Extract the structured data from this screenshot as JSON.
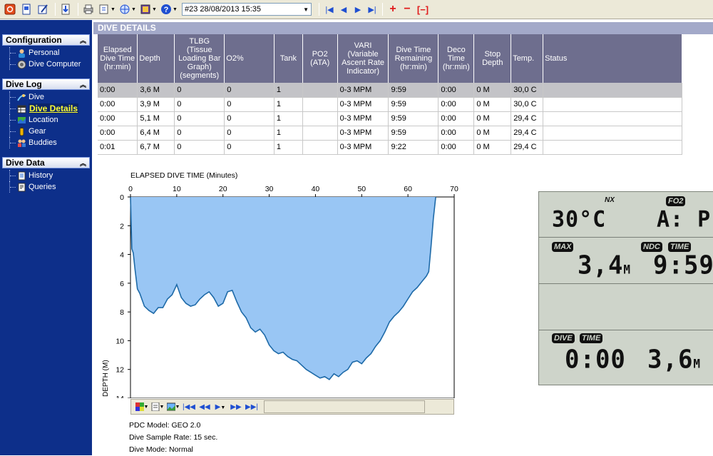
{
  "toolbar": {
    "dive_selector": "#23 28/08/2013 15:35",
    "icons": [
      "exit-icon",
      "new-icon",
      "edit-icon",
      "download-icon",
      "print-icon",
      "export-icon",
      "web-icon",
      "settings-icon",
      "help-icon"
    ],
    "nav": [
      "first-icon",
      "previous-icon",
      "next-icon",
      "last-icon"
    ],
    "add": "+",
    "remove": "−",
    "remove_bracket": "[−]"
  },
  "sidebar": {
    "configuration": {
      "title": "Configuration",
      "items": [
        "Personal",
        "Dive Computer"
      ]
    },
    "dive_log": {
      "title": "Dive Log",
      "items": [
        "Dive",
        "Dive Details",
        "Location",
        "Gear",
        "Buddies"
      ]
    },
    "dive_data": {
      "title": "Dive Data",
      "items": [
        "History",
        "Queries"
      ]
    }
  },
  "main": {
    "title": "DIVE DETAILS",
    "columns": [
      "Elapsed Dive Time (hr:min)",
      "Depth",
      "TLBG (Tissue Loading Bar Graph) (segments)",
      "O2%",
      "Tank",
      "PO2 (ATA)",
      "VARI (Variable Ascent Rate Indicator)",
      "Dive Time Remaining (hr:min)",
      "Deco Time (hr:min)",
      "Stop Depth",
      "Temp.",
      "Status"
    ],
    "rows": [
      [
        "0:00",
        "3,6 M",
        "0",
        "0",
        "1",
        "",
        "0-3 MPM",
        "9:59",
        "0:00",
        "0 M",
        "30,0 C",
        ""
      ],
      [
        "0:00",
        "3,9 M",
        "0",
        "0",
        "1",
        "",
        "0-3 MPM",
        "9:59",
        "0:00",
        "0 M",
        "30,0 C",
        ""
      ],
      [
        "0:00",
        "5,1 M",
        "0",
        "0",
        "1",
        "",
        "0-3 MPM",
        "9:59",
        "0:00",
        "0 M",
        "29,4 C",
        ""
      ],
      [
        "0:00",
        "6,4 M",
        "0",
        "0",
        "1",
        "",
        "0-3 MPM",
        "9:59",
        "0:00",
        "0 M",
        "29,4 C",
        ""
      ],
      [
        "0:01",
        "6,7 M",
        "0",
        "0",
        "1",
        "",
        "0-3 MPM",
        "9:22",
        "0:00",
        "0 M",
        "29,4 C",
        ""
      ]
    ]
  },
  "chart_data": {
    "type": "area",
    "title": "ELAPSED DIVE TIME (Minutes)",
    "ylabel": "DEPTH (M)",
    "xlim": [
      0,
      70
    ],
    "ylim": [
      14,
      0
    ],
    "x_ticks": [
      0,
      10,
      20,
      30,
      40,
      50,
      60,
      70
    ],
    "y_ticks": [
      0,
      2,
      4,
      6,
      8,
      10,
      12,
      14
    ],
    "x": [
      0,
      0.3,
      0.6,
      1,
      1.5,
      2,
      3,
      4,
      5,
      6,
      7,
      8,
      9,
      10,
      11,
      12,
      13,
      14,
      15,
      16,
      17,
      18,
      19,
      20,
      21,
      22,
      23,
      24,
      25,
      26,
      27,
      28,
      29,
      30,
      31,
      32,
      33,
      34,
      35,
      36,
      37,
      38,
      39,
      40,
      41,
      42,
      43,
      44,
      45,
      46,
      47,
      48,
      49,
      50,
      51,
      52,
      53,
      54,
      55,
      56,
      57,
      58,
      59,
      60,
      61,
      62,
      63,
      64,
      64.5,
      65,
      65.5,
      66
    ],
    "depth": [
      0,
      3.6,
      3.9,
      5.1,
      6.4,
      6.7,
      7.6,
      7.9,
      8.1,
      7.7,
      7.7,
      7.1,
      6.8,
      6.1,
      7.0,
      7.4,
      7.6,
      7.5,
      7.1,
      6.8,
      6.6,
      7.0,
      7.6,
      7.4,
      6.6,
      6.5,
      7.3,
      8.0,
      8.4,
      9.1,
      9.4,
      9.2,
      9.6,
      10.3,
      10.7,
      10.9,
      10.8,
      11.1,
      11.3,
      11.4,
      11.7,
      12.0,
      12.2,
      12.4,
      12.6,
      12.5,
      12.7,
      12.3,
      12.5,
      12.2,
      12.0,
      11.5,
      11.4,
      11.6,
      11.2,
      10.9,
      10.4,
      10.0,
      9.4,
      8.7,
      8.3,
      8.0,
      7.6,
      7.1,
      6.6,
      6.3,
      5.9,
      5.5,
      5.2,
      3.4,
      1.5,
      0
    ]
  },
  "info": {
    "model": "PDC Model: GEO 2.0",
    "sample_rate": "Dive Sample Rate: 15 sec.",
    "mode": "Dive Mode: Normal"
  },
  "lcd": {
    "mode": "NX",
    "fo2_tag": "FO2",
    "temp": "30°C",
    "fo2_value": "A: P",
    "max_tag": "MAX",
    "ndc_tag": "NDC",
    "time_tag": "TIME",
    "max_depth": "3,4",
    "max_unit": "M",
    "ndc_time": "9:59",
    "dive_tag": "DIVE",
    "dive_time_tag": "TIME",
    "dive_time": "0:00",
    "current_depth": "3,6",
    "current_unit": "M"
  }
}
